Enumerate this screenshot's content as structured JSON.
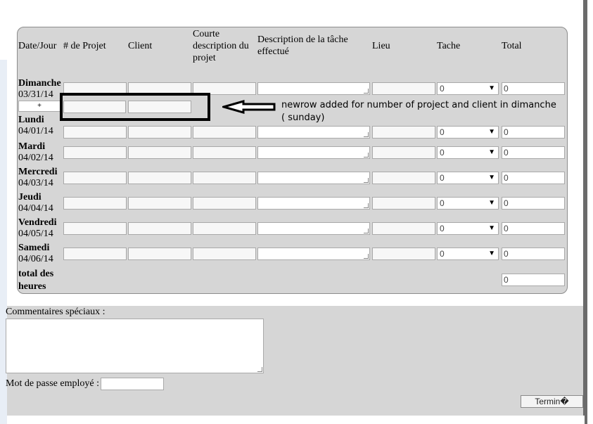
{
  "headers": {
    "date": "Date/Jour",
    "project_num": "# de Projet",
    "client": "Client",
    "short_desc": "Courte description du projet",
    "task_desc": "Description de la tâche effectué",
    "place": "Lieu",
    "task": "Tache",
    "total": "Total"
  },
  "days": [
    {
      "name": "Dimanche",
      "date": "03/31/14",
      "task": "0",
      "total": "0"
    },
    {
      "name": "Lundi",
      "date": "04/01/14",
      "task": "0",
      "total": "0"
    },
    {
      "name": "Mardi",
      "date": "04/02/14",
      "task": "0",
      "total": "0"
    },
    {
      "name": "Mercredi",
      "date": "04/03/14",
      "task": "0",
      "total": "0"
    },
    {
      "name": "Jeudi",
      "date": "04/04/14",
      "task": "0",
      "total": "0"
    },
    {
      "name": "Vendredi",
      "date": "04/05/14",
      "task": "0",
      "total": "0"
    },
    {
      "name": "Samedi",
      "date": "04/06/14",
      "task": "0",
      "total": "0"
    }
  ],
  "add_row_label": "+",
  "annotation": "newrow added for number of project and client in dimanche ( sunday)",
  "total_hours": {
    "label": "total des heures",
    "value": "0"
  },
  "comments_label": "Commentaires spéciaux :",
  "password_label": "Mot de passe employé :",
  "finish_button": "Termin�"
}
